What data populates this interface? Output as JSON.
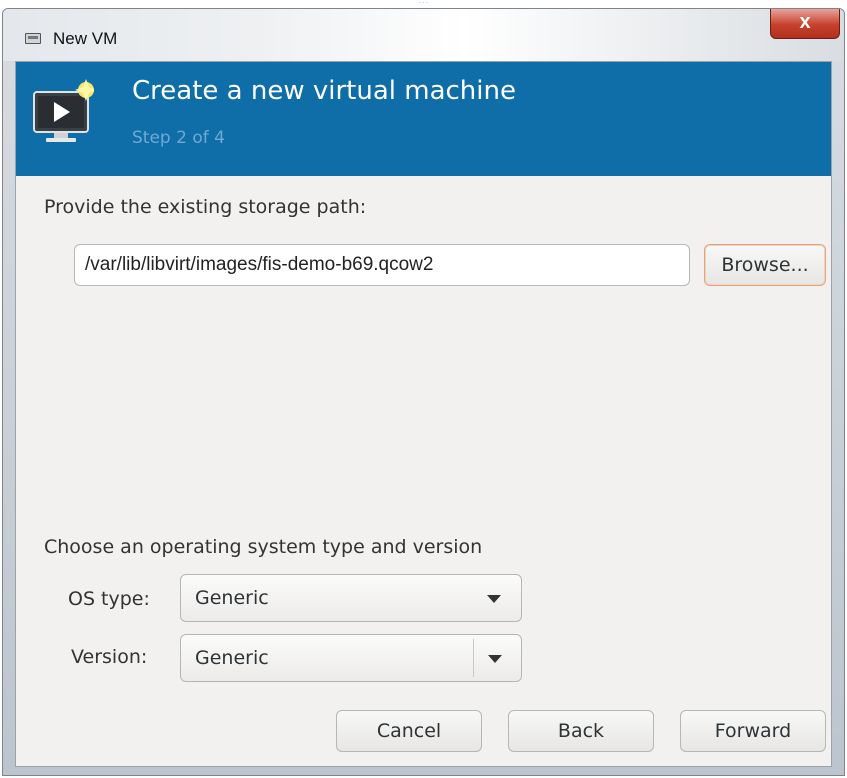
{
  "background_text": "...",
  "window": {
    "title": "New VM",
    "close_glyph": "x"
  },
  "header": {
    "title": "Create a new virtual machine",
    "step": "Step 2 of 4",
    "icon": "vm-monitor-icon",
    "bg_color": "#0f6da8"
  },
  "storage": {
    "label": "Provide the existing storage path:",
    "path_value": "/var/lib/libvirt/images/fis-demo-b69.qcow2",
    "browse_label": "Browse..."
  },
  "os": {
    "section_label": "Choose an operating system type and version",
    "type_label": "OS type:",
    "type_value": "Generic",
    "version_label": "Version:",
    "version_value": "Generic"
  },
  "buttons": {
    "cancel": "Cancel",
    "back": "Back",
    "forward": "Forward"
  }
}
